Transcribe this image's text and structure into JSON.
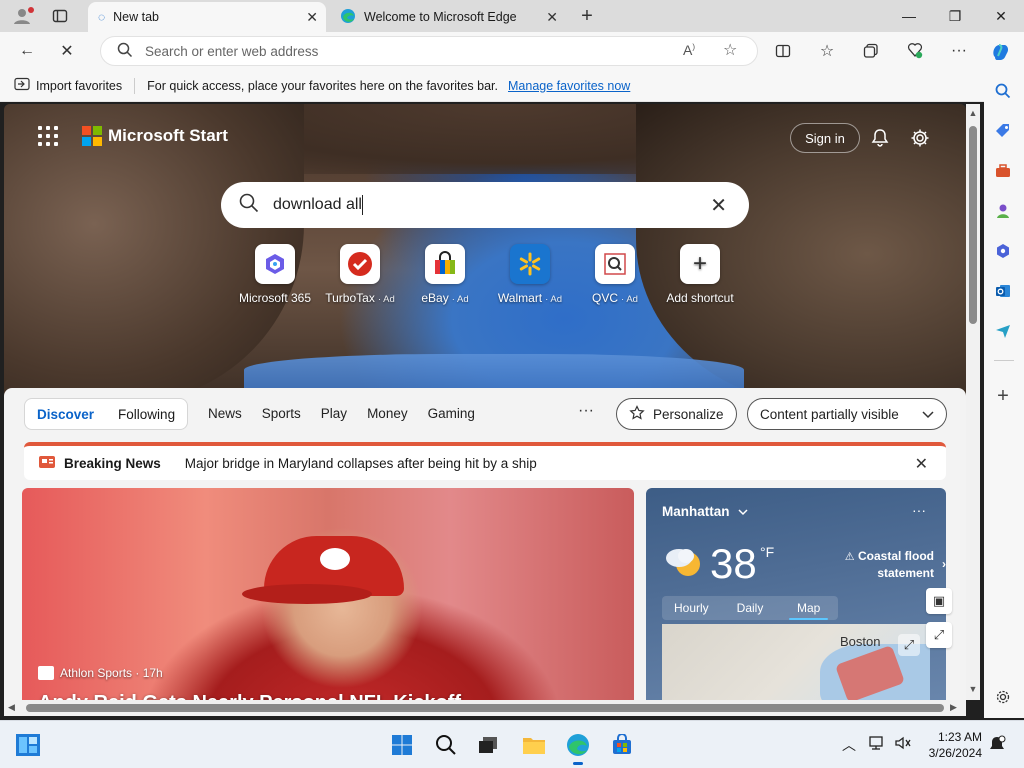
{
  "tabs": [
    {
      "title": "New tab",
      "active": true
    },
    {
      "title": "Welcome to Microsoft Edge",
      "active": false
    }
  ],
  "address_bar": {
    "placeholder": "Search or enter web address"
  },
  "favorites_bar": {
    "import_label": "Import favorites",
    "message": "For quick access, place your favorites here on the favorites bar.",
    "manage_link": "Manage favorites now"
  },
  "start": {
    "brand": "Microsoft Start",
    "sign_in": "Sign in",
    "search_value": "download all"
  },
  "shortcuts": [
    {
      "label": "Microsoft 365",
      "ad": ""
    },
    {
      "label": "TurboTax",
      "ad": "· Ad"
    },
    {
      "label": "eBay",
      "ad": "· Ad"
    },
    {
      "label": "Walmart",
      "ad": "· Ad"
    },
    {
      "label": "QVC",
      "ad": "· Ad"
    },
    {
      "label": "Add shortcut",
      "ad": ""
    }
  ],
  "feed_nav": {
    "discover": "Discover",
    "following": "Following",
    "links": [
      "News",
      "Sports",
      "Play",
      "Money",
      "Gaming"
    ],
    "personalize": "Personalize",
    "content_visibility": "Content partially visible"
  },
  "breaking": {
    "label": "Breaking News",
    "text": "Major bridge in Maryland collapses after being hit by a ship"
  },
  "story": {
    "source": "Athlon Sports · 17h",
    "headline": "Andy Reid Gets Nearly Personal NFL Kickoff..."
  },
  "weather": {
    "location": "Manhattan",
    "temperature": "38",
    "unit": "°F",
    "alert": "Coastal flood statement",
    "tabs": [
      "Hourly",
      "Daily",
      "Map"
    ],
    "selected_tab": "Map",
    "map_city": "Boston"
  },
  "taskbar": {
    "time": "1:23 AM",
    "date": "3/26/2024"
  },
  "colors": {
    "accent": "#0a63c9",
    "breaking": "#e0583b",
    "weather_bg": "#4f6d95"
  }
}
